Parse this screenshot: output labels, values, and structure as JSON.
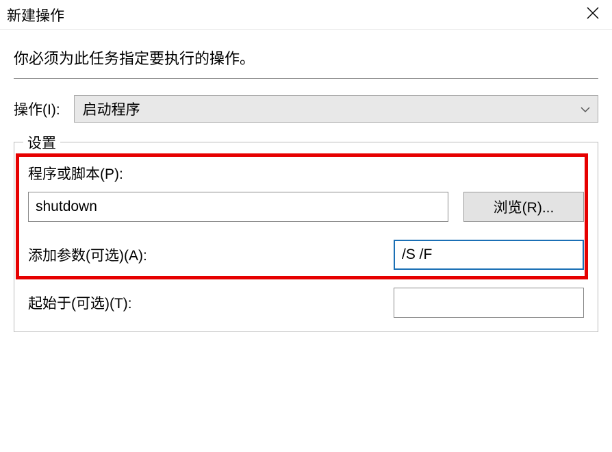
{
  "titlebar": {
    "title": "新建操作"
  },
  "instruction": "你必须为此任务指定要执行的操作。",
  "action": {
    "label": "操作(I):",
    "selected": "启动程序"
  },
  "settings": {
    "legend": "设置",
    "program": {
      "label": "程序或脚本(P):",
      "value": "shutdown",
      "browse": "浏览(R)..."
    },
    "arguments": {
      "label": "添加参数(可选)(A):",
      "value": "/S /F"
    },
    "startin": {
      "label": "起始于(可选)(T):",
      "value": ""
    }
  }
}
